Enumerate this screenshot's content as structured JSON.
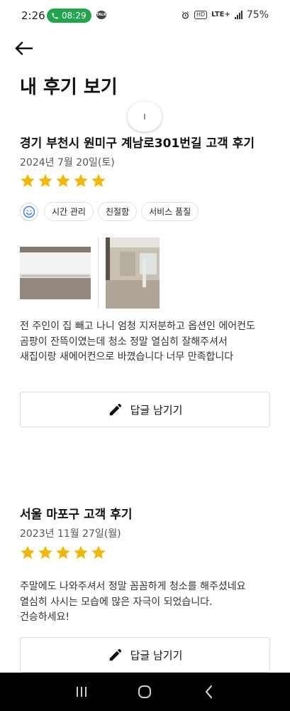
{
  "status_bar": {
    "time": "2:26",
    "call_time": "08:29",
    "talk_badge": "TALK",
    "hd": "HD",
    "network": "LTE+",
    "battery": "75%"
  },
  "header": {
    "title": "내 후기 보기"
  },
  "spinner": {
    "glyph": "ı"
  },
  "reviews": [
    {
      "title": "경기 부천시 원미구 계남로301번길 고객 후기",
      "date": "2024년 7월 20일(토)",
      "rating": 5,
      "tags": [
        "시간 관리",
        "친절함",
        "서비스 품질"
      ],
      "text_lines": [
        "전 주인이 집 빼고 나니 엄청 지저분하고 옵션인 에어컨도",
        "곰팡이 잔뜩이였는데 청소 정말 열심히 잘해주셔서",
        "새집이랑 새에어컨으로 바꼈습니다 너무 만족합니다"
      ],
      "reply_label": "답글 남기기"
    },
    {
      "title": "서울 마포구 고객 후기",
      "date": "2023년 11월 27일(월)",
      "rating": 5,
      "text_lines": [
        "주말에도 나와주셔서 정말 꼼꼼하게 청소를 해주셨네요",
        "열심히 사시는 모습에 많은 자극이 되었습니다.",
        "건승하세요!"
      ],
      "reply_label": "답글 남기기"
    }
  ],
  "colors": {
    "star": "#f5b800",
    "accent_green": "#1fa64a",
    "smile_icon": "#3b82f6",
    "nav_bar": "#000000"
  }
}
